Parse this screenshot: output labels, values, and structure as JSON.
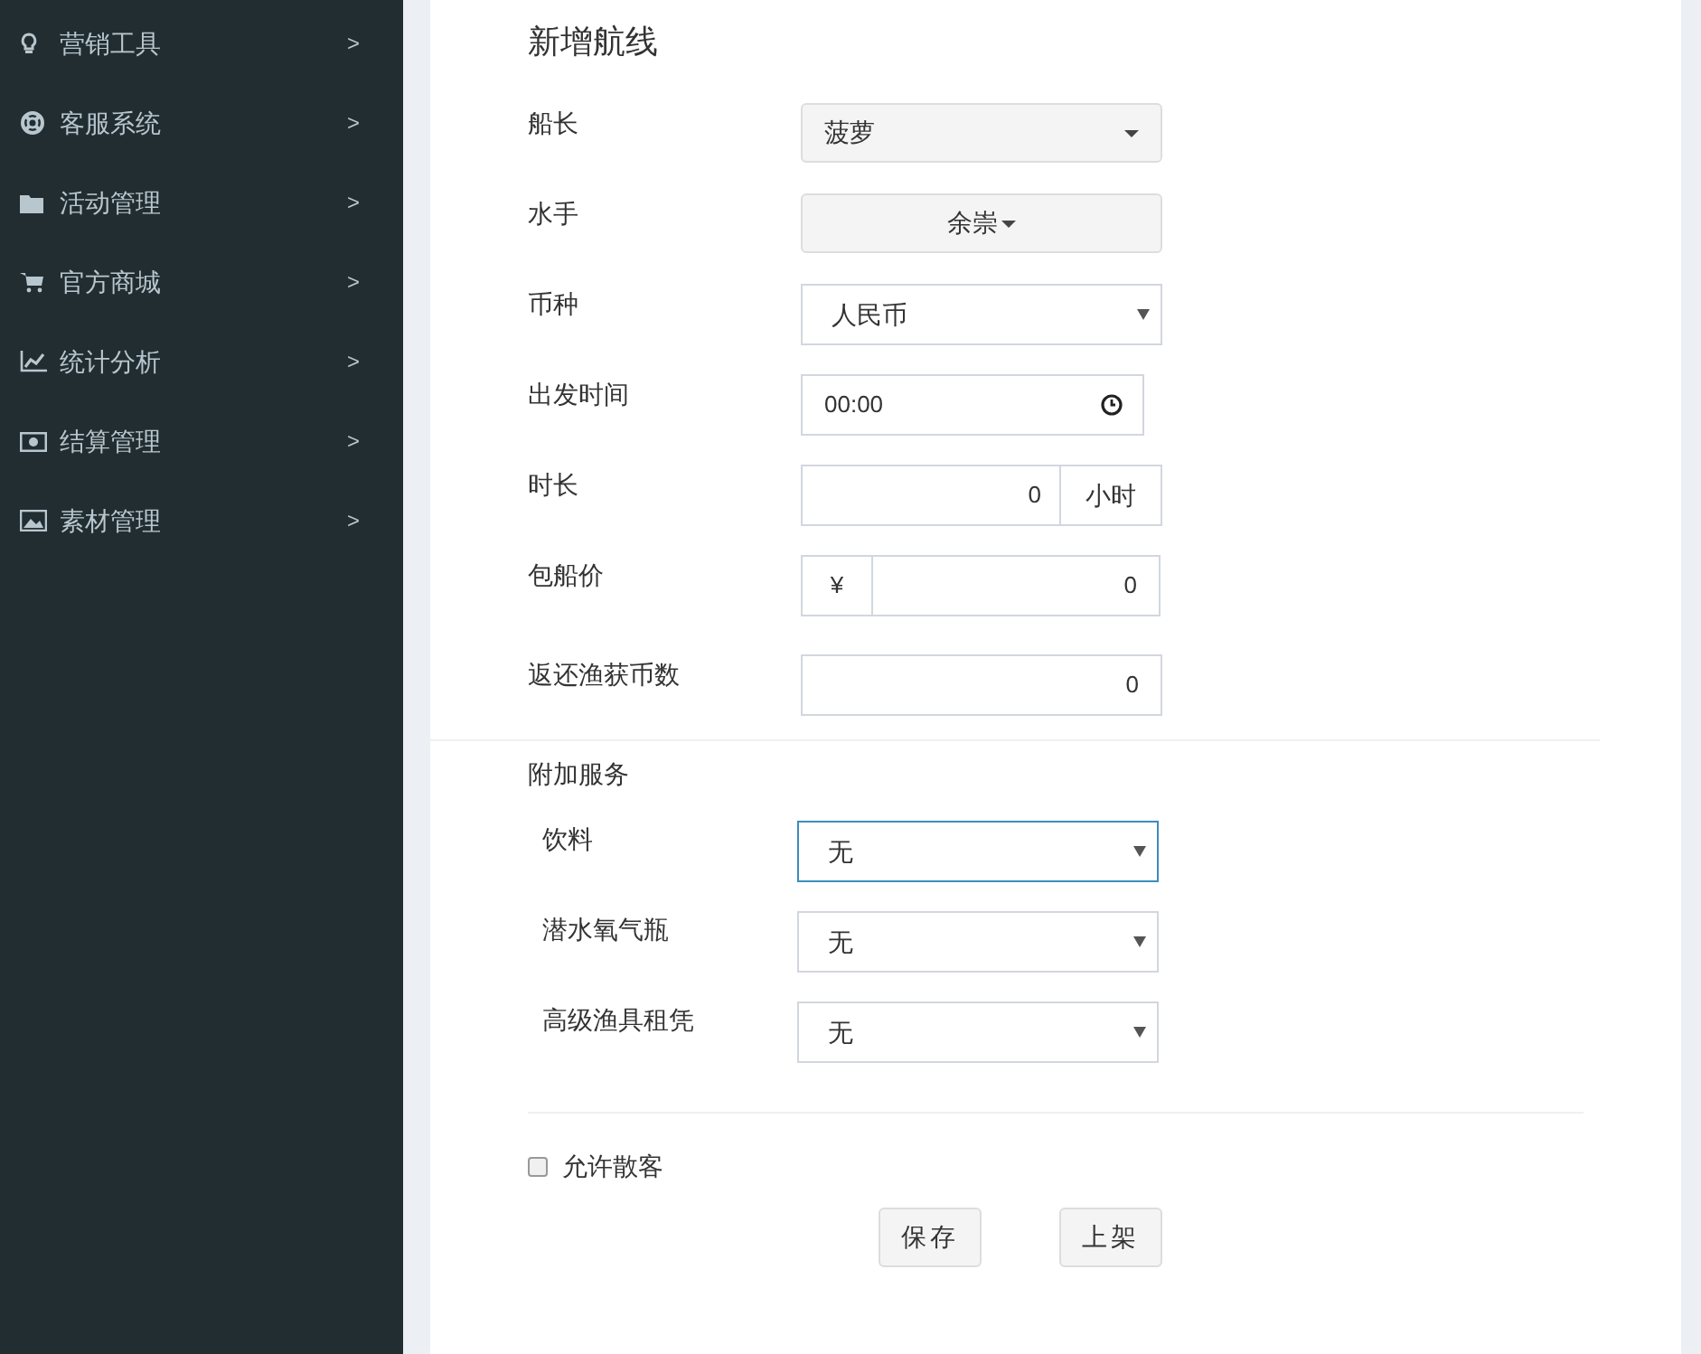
{
  "sidebar": {
    "items": [
      {
        "label": "营销工具",
        "chevron": ">"
      },
      {
        "label": "客服系统",
        "chevron": ">"
      },
      {
        "label": "活动管理",
        "chevron": ">"
      },
      {
        "label": "官方商城",
        "chevron": ">"
      },
      {
        "label": "统计分析",
        "chevron": ">"
      },
      {
        "label": "结算管理",
        "chevron": ">"
      },
      {
        "label": "素材管理",
        "chevron": ">"
      }
    ]
  },
  "form": {
    "title": "新增航线",
    "fields": [
      {
        "kind": "dropdown",
        "label": "船长",
        "value": "菠萝"
      },
      {
        "kind": "split",
        "label": "水手",
        "value": "余崇"
      },
      {
        "kind": "select",
        "label": "币种",
        "value": "人民币"
      },
      {
        "kind": "time",
        "label": "出发时间",
        "value": "00:00"
      },
      {
        "kind": "suffix",
        "label": "时长",
        "value": "0",
        "addon": "小时"
      },
      {
        "kind": "prefix",
        "label": "包船价",
        "value": "0",
        "addon": "¥"
      },
      {
        "kind": "input",
        "label": "返还渔获币数",
        "value": "0"
      }
    ],
    "extras": {
      "title": "附加服务",
      "items": [
        {
          "label": "饮料",
          "value": "无",
          "focused": true
        },
        {
          "label": "潜水氧气瓶",
          "value": "无",
          "focused": false
        },
        {
          "label": "高级渔具租凭",
          "value": "无",
          "focused": false
        }
      ]
    },
    "allow_walk_in": {
      "label": "允许散客",
      "checked": false
    },
    "buttons": [
      "保存",
      "上架"
    ]
  }
}
